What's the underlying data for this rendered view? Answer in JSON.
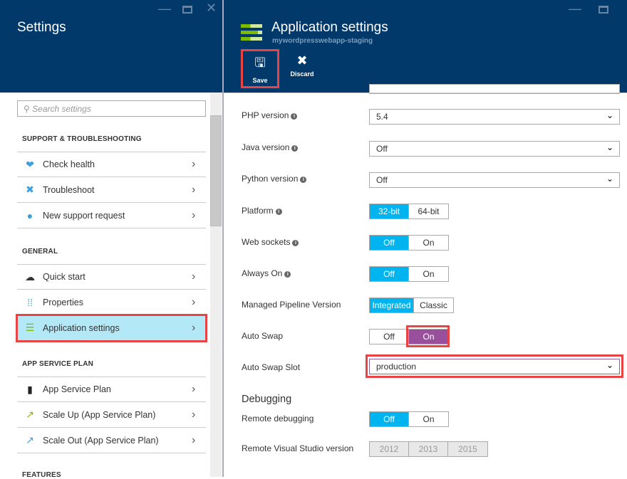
{
  "left": {
    "title": "Settings",
    "search_placeholder": "Search settings",
    "sections": [
      {
        "title": "SUPPORT & TROUBLESHOOTING",
        "items": [
          {
            "label": "Check health",
            "icon": "heart-pulse-icon"
          },
          {
            "label": "Troubleshoot",
            "icon": "tools-icon"
          },
          {
            "label": "New support request",
            "icon": "support-person-icon"
          }
        ]
      },
      {
        "title": "GENERAL",
        "items": [
          {
            "label": "Quick start",
            "icon": "cloud-icon"
          },
          {
            "label": "Properties",
            "icon": "sliders-icon"
          },
          {
            "label": "Application settings",
            "icon": "app-settings-icon",
            "selected": true
          }
        ]
      },
      {
        "title": "APP SERVICE PLAN",
        "items": [
          {
            "label": "App Service Plan",
            "icon": "server-icon"
          },
          {
            "label": "Scale Up (App Service Plan)",
            "icon": "scale-up-icon"
          },
          {
            "label": "Scale Out (App Service Plan)",
            "icon": "scale-out-icon"
          }
        ]
      },
      {
        "title": "FEATURES"
      }
    ]
  },
  "right": {
    "title": "Application settings",
    "subtitle": "mywordpresswebapp-staging",
    "save": "Save",
    "discard": "Discard",
    "php": {
      "label": "PHP version",
      "value": "5.4"
    },
    "java": {
      "label": "Java version",
      "value": "Off"
    },
    "python": {
      "label": "Python version",
      "value": "Off"
    },
    "platform": {
      "label": "Platform",
      "options": [
        "32-bit",
        "64-bit"
      ],
      "selected": "32-bit"
    },
    "websockets": {
      "label": "Web sockets",
      "options": [
        "Off",
        "On"
      ],
      "selected": "Off"
    },
    "alwayson": {
      "label": "Always On",
      "options": [
        "Off",
        "On"
      ],
      "selected": "Off"
    },
    "pipeline": {
      "label": "Managed Pipeline Version",
      "options": [
        "Integrated",
        "Classic"
      ],
      "selected": "Integrated"
    },
    "autoswap": {
      "label": "Auto Swap",
      "options": [
        "Off",
        "On"
      ],
      "selected": "On"
    },
    "autoswapslot": {
      "label": "Auto Swap Slot",
      "value": "production"
    },
    "debugging": "Debugging",
    "remotedebug": {
      "label": "Remote debugging",
      "options": [
        "Off",
        "On"
      ],
      "selected": "Off"
    },
    "rvs": {
      "label": "Remote Visual Studio version",
      "options": [
        "2012",
        "2013",
        "2015"
      ]
    }
  },
  "colors": {
    "header": "#013a6a",
    "accent": "#00b4f0",
    "selected_item": "#b3e8f7",
    "highlight": "#e84444",
    "autoswap_on": "#9a4f9c"
  }
}
